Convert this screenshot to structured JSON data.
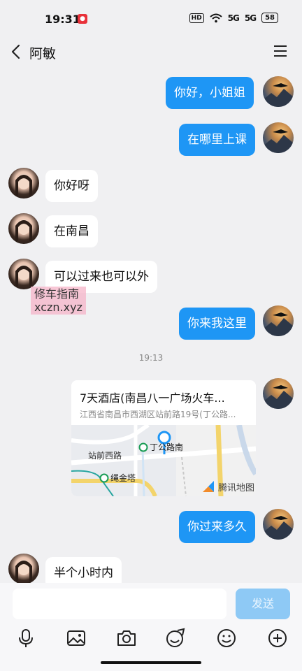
{
  "status_bar": {
    "time": "19:31",
    "hd": "HD",
    "signal_1": "5G",
    "signal_2": "5G",
    "battery": "58"
  },
  "header": {
    "title": "阿敏"
  },
  "messages": [
    {
      "side": "self",
      "text": "你好，小姐姐"
    },
    {
      "side": "self",
      "text": "在哪里上课"
    },
    {
      "side": "peer",
      "text": "你好呀"
    },
    {
      "side": "peer",
      "text": "在南昌"
    },
    {
      "side": "peer",
      "text": "可以过来也可以外"
    },
    {
      "side": "self",
      "text": "你来我这里"
    },
    {
      "side": "self",
      "text": "你过来多久"
    },
    {
      "side": "peer",
      "text": "半个小时内"
    }
  ],
  "watermark": {
    "line1": "修车指南",
    "line2": "xczn.xyz"
  },
  "timestamp": "19:13",
  "location_card": {
    "name": "7天酒店(南昌八一广场火车...",
    "address": "江西省南昌市西湖区站前路19号(丁公路...",
    "map_labels": {
      "station_1": "丁公路南",
      "road": "站前西路",
      "station_2": "绳金塔",
      "provider": "腾讯地图"
    }
  },
  "input_bar": {
    "placeholder": "",
    "send_label": "发送"
  },
  "colors": {
    "self_bubble": "#1e96f5",
    "peer_bubble": "#ffffff",
    "send_disabled": "#8ec9f5",
    "background": "#f0f0f2"
  }
}
